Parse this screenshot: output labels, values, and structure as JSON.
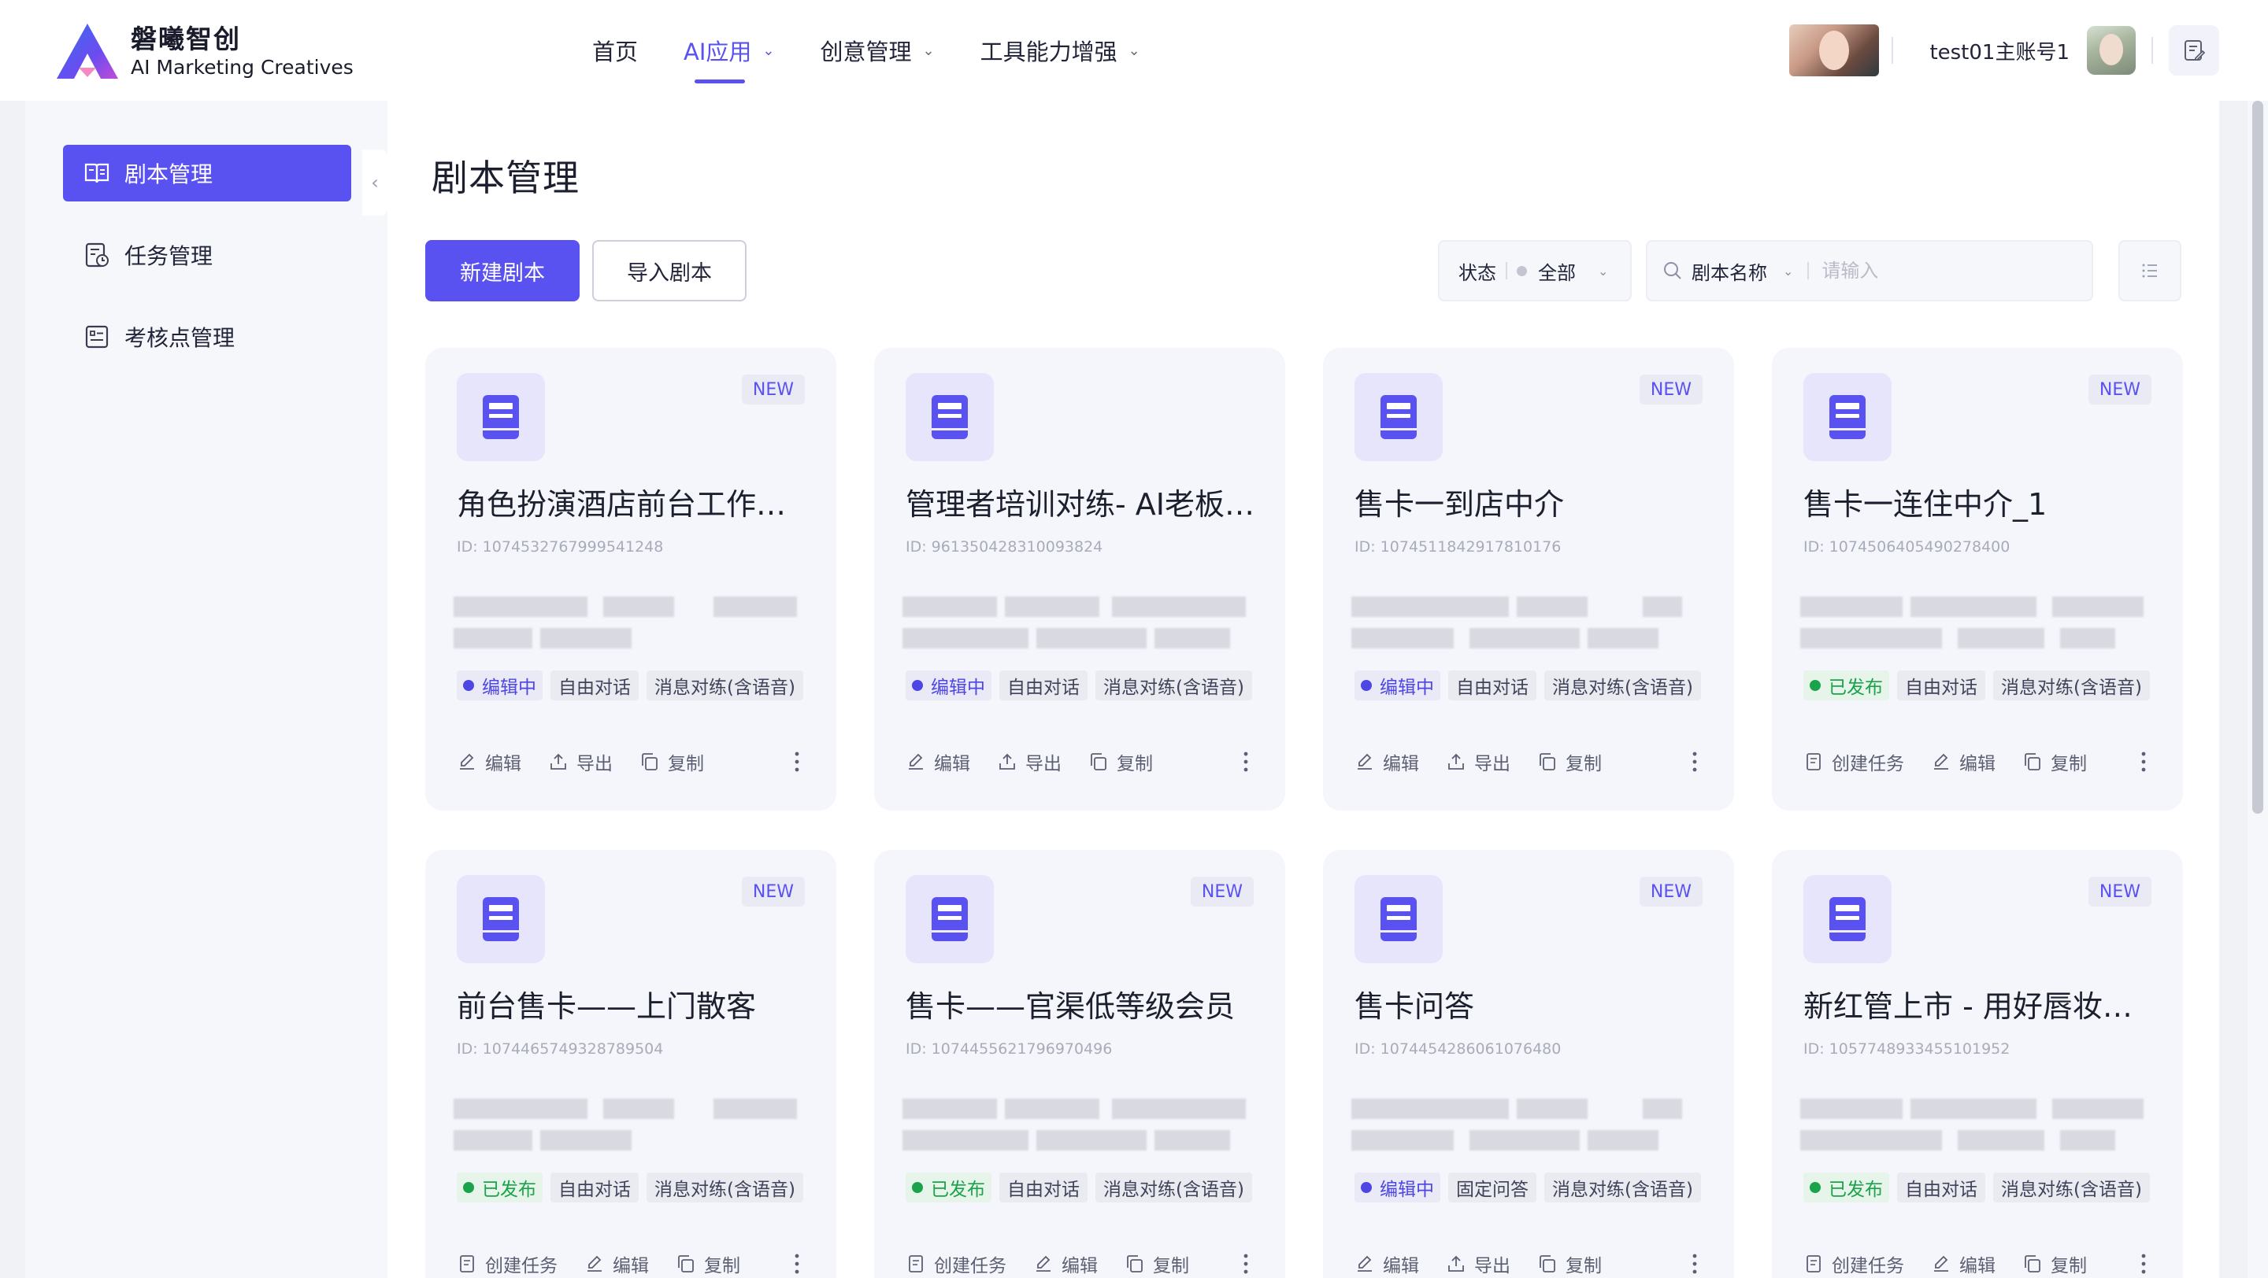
{
  "header": {
    "logo_cn": "磐曦智创",
    "logo_en": "AI Marketing Creatives",
    "nav": [
      {
        "label": "首页",
        "dropdown": false,
        "active": false
      },
      {
        "label": "AI应用",
        "dropdown": true,
        "active": true
      },
      {
        "label": "创意管理",
        "dropdown": true,
        "active": false
      },
      {
        "label": "工具能力增强",
        "dropdown": true,
        "active": false
      }
    ],
    "account": "test01主账号1"
  },
  "sidebar": {
    "items": [
      {
        "label": "剧本管理",
        "icon": "book-open-icon",
        "active": true
      },
      {
        "label": "任务管理",
        "icon": "task-clock-icon",
        "active": false
      },
      {
        "label": "考核点管理",
        "icon": "checklist-icon",
        "active": false
      }
    ]
  },
  "main": {
    "title": "剧本管理",
    "new_button": "新建剧本",
    "import_button": "导入剧本",
    "status_filter": {
      "label": "状态",
      "value": "全部"
    },
    "search": {
      "field": "剧本名称",
      "placeholder": "请输入"
    }
  },
  "cards": [
    {
      "badge": "NEW",
      "name": "角色扮演酒店前台工作人员",
      "id": "ID: 1074532767999541248",
      "status": "编辑中",
      "status_type": "editing",
      "tags": [
        "自由对话",
        "消息对练(含语音)"
      ],
      "actions": [
        "编辑",
        "导出",
        "复制"
      ]
    },
    {
      "badge": "",
      "name": "管理者培训对练- AI老板考核",
      "id": "ID: 961350428310093824",
      "status": "编辑中",
      "status_type": "editing",
      "tags": [
        "自由对话",
        "消息对练(含语音)"
      ],
      "actions": [
        "编辑",
        "导出",
        "复制"
      ]
    },
    {
      "badge": "NEW",
      "name": "售卡一到店中介",
      "id": "ID: 1074511842917810176",
      "status": "编辑中",
      "status_type": "editing",
      "tags": [
        "自由对话",
        "消息对练(含语音)"
      ],
      "actions": [
        "编辑",
        "导出",
        "复制"
      ]
    },
    {
      "badge": "NEW",
      "name": "售卡一连住中介_1",
      "id": "ID: 1074506405490278400",
      "status": "已发布",
      "status_type": "published",
      "tags": [
        "自由对话",
        "消息对练(含语音)"
      ],
      "actions": [
        "创建任务",
        "编辑",
        "复制"
      ]
    },
    {
      "badge": "NEW",
      "name": "前台售卡——上门散客",
      "id": "ID: 1074465749328789504",
      "status": "已发布",
      "status_type": "published",
      "tags": [
        "自由对话",
        "消息对练(含语音)"
      ],
      "actions": [
        "创建任务",
        "编辑",
        "复制"
      ]
    },
    {
      "badge": "NEW",
      "name": "售卡——官渠低等级会员",
      "id": "ID: 1074455621796970496",
      "status": "已发布",
      "status_type": "published",
      "tags": [
        "自由对话",
        "消息对练(含语音)"
      ],
      "actions": [
        "创建任务",
        "编辑",
        "复制"
      ]
    },
    {
      "badge": "NEW",
      "name": "售卡问答",
      "id": "ID: 1074454286061076480",
      "status": "编辑中",
      "status_type": "editing",
      "tags": [
        "固定问答",
        "消息对练(含语音)"
      ],
      "actions": [
        "编辑",
        "导出",
        "复制"
      ]
    },
    {
      "badge": "NEW",
      "name": "新红管上市 - 用好唇妆产品介绍",
      "id": "ID: 1057748933455101952",
      "status": "已发布",
      "status_type": "published",
      "tags": [
        "自由对话",
        "消息对练(含语音)"
      ],
      "actions": [
        "创建任务",
        "编辑",
        "复制"
      ]
    }
  ]
}
